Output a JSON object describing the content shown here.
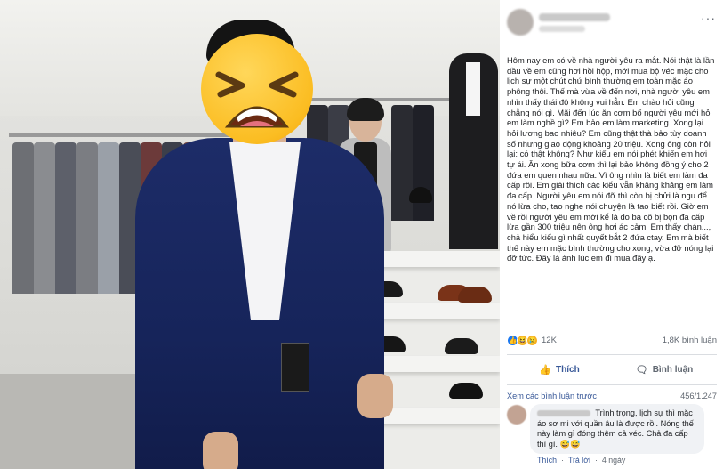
{
  "post": {
    "text": "Hôm nay em có về nhà người yêu ra mắt. Nói thật là lần đầu về em cũng hơi hồi hộp, mới mua bộ véc mặc cho lịch sự một chút chứ bình thường em toàn mặc áo phông thôi. Thế mà vừa về đến nơi, nhà người yêu em nhìn thấy thái độ không vui hẳn. Em chào hỏi cũng chẳng nói gì. Mãi đến lúc ăn cơm bố người yêu mới hỏi em làm nghề gì? Em bảo em làm marketing. Xong lại hỏi lương bao nhiêu? Em cũng thật thà bảo tùy doanh số nhưng giao động khoảng 20 triệu. Xong ông còn hỏi lại: có thật không? Như kiểu em nói phét khiến em hơi tự ái. Ăn xong bữa cơm thì lại bảo không đồng ý cho 2 đứa em quen nhau nữa. Vì ông nhìn là biết em làm đa cấp rồi. Em giải thích các kiểu vẫn khăng khăng em làm đa cấp. Người yêu em nói đỡ thì còn bị chửi là ngu để nó lừa cho, tao nghe nói chuyện là tao biết rồi. Giờ em về rồi người yêu em mới kể là do bà cô bị bọn đa cấp lừa gần 300 triệu nên ông hơi ác cảm. Em thấy chán..., chả hiểu kiểu gì nhất quyết bắt 2 đứa ctay. Em mà biết thế này em mặc bình thường cho xong, vừa đỡ nóng lại đỡ tức. Đây là ảnh lúc em đi mua đây ạ.",
    "more_icon": "···",
    "reactions": {
      "icons": [
        "like-icon",
        "haha-icon",
        "sad-icon"
      ],
      "count": "12K",
      "comments": "1,8K bình luận",
      "colors": {
        "like": "#1877f2",
        "haha": "#f7b125",
        "sad": "#f7b125"
      }
    },
    "actions": {
      "like": "Thích",
      "comment": "Bình luận"
    },
    "comments_section": {
      "view_more": "Xem các bình luận trước",
      "counter": "456/1.247",
      "comment_text": "Trình trọng, lịch sự thì mặc áo sơ mi với quần âu là được rồi. Nóng thế này làm gì đóng thêm cả véc. Chả đa cấp thì gì. 😅😅",
      "comment_actions": {
        "like": "Thích",
        "reply": "Trả lời",
        "time": "4 ngày"
      }
    }
  },
  "photo": {
    "emoji": "tired-face-emoji"
  },
  "colors": {
    "link": "#385898",
    "muted": "#606770",
    "bubble": "#f0f2f5",
    "suit": "#1d2c68"
  }
}
